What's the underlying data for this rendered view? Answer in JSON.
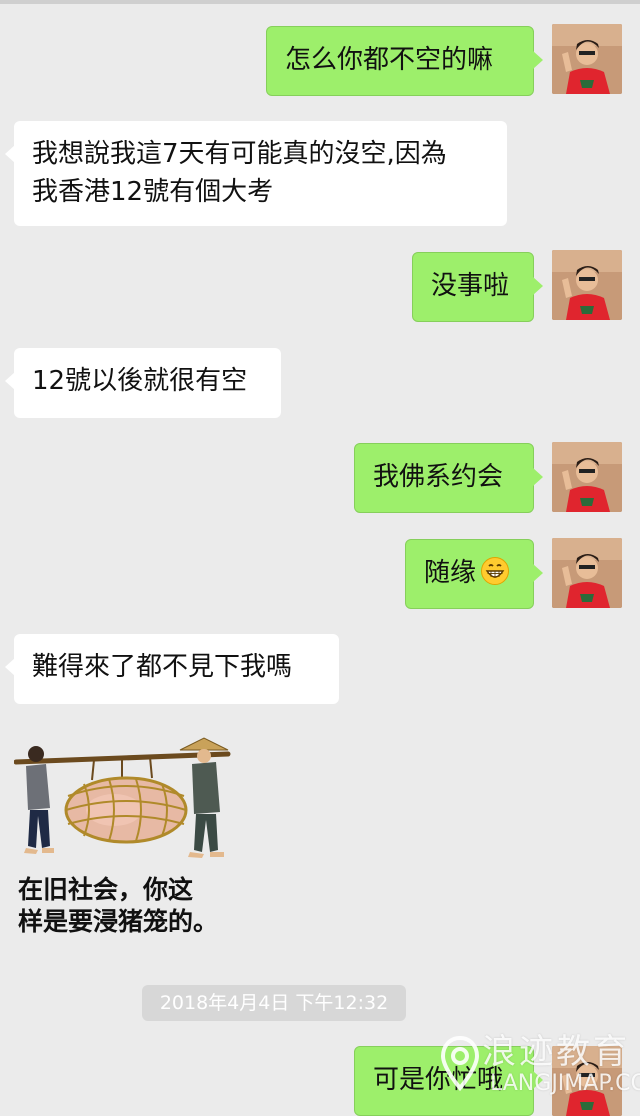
{
  "messages": [
    {
      "side": "out",
      "text": "怎么你都不空的嘛"
    },
    {
      "side": "in",
      "line1": "我想說我這7天有可能真的沒空,因為",
      "line2": "我香港12號有個大考"
    },
    {
      "side": "out",
      "text": "没事啦"
    },
    {
      "side": "in",
      "text": "12號以後就很有空"
    },
    {
      "side": "out",
      "text": "我佛系约会"
    },
    {
      "side": "out",
      "text": "随缘",
      "emoji": "grinning-face-icon"
    },
    {
      "side": "in",
      "text": "難得來了都不見下我嗎"
    },
    {
      "side": "in",
      "type": "sticker",
      "caption": "在旧社会，你这\n样是要浸猪笼的。"
    },
    {
      "side": "out",
      "text": "可是你忙哦"
    }
  ],
  "timestamp": "2018年4月4日 下午12:32",
  "watermark": {
    "main": "浪迹教育",
    "sub": "LANGJIMAP.COM"
  },
  "colors": {
    "background": "#ebebeb",
    "incoming_bubble": "#ffffff",
    "outgoing_bubble": "#9def6b",
    "avatar_shirt": "#e0252e"
  }
}
